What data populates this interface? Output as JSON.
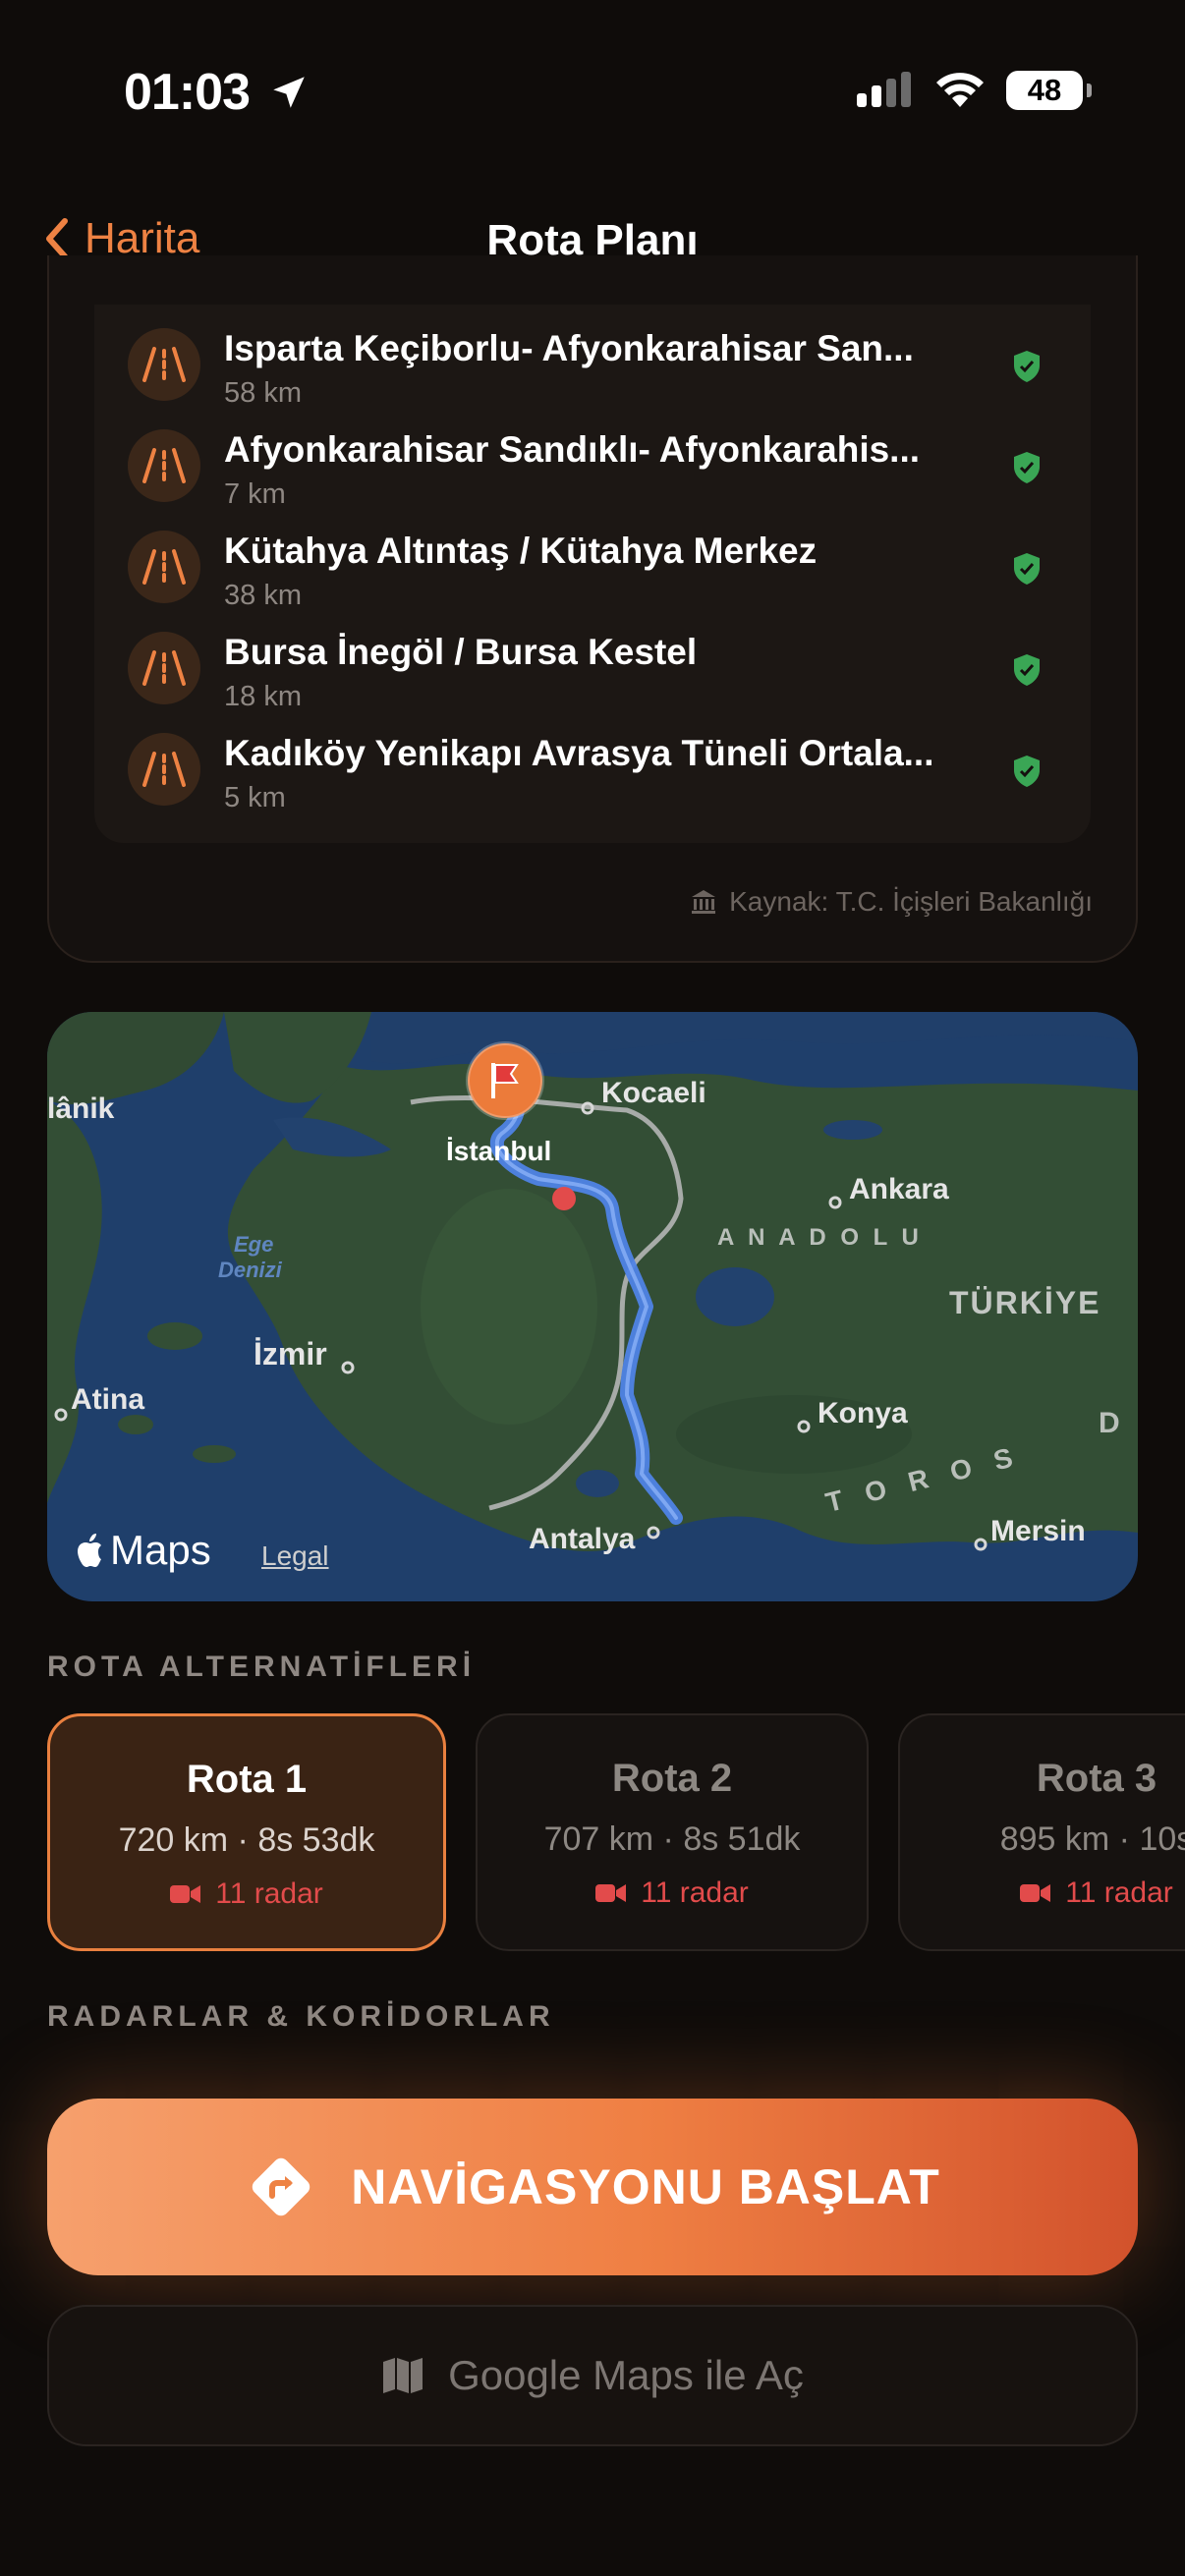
{
  "status": {
    "time": "01:03",
    "battery": "48"
  },
  "nav": {
    "back_label": "Harita",
    "title": "Rota Planı"
  },
  "corridors": [
    {
      "title": "Isparta Keçiborlu- Afyonkarahisar San...",
      "distance": "58 km"
    },
    {
      "title": "Afyonkarahisar Sandıklı- Afyonkarahis...",
      "distance": "7 km"
    },
    {
      "title": "Kütahya Altıntaş / Kütahya Merkez",
      "distance": "38 km"
    },
    {
      "title": "Bursa İnegöl / Bursa Kestel",
      "distance": "18 km"
    },
    {
      "title": "Kadıköy Yenikapı Avrasya Tüneli Ortala...",
      "distance": "5 km"
    }
  ],
  "source": "Kaynak: T.C. İçişleri Bakanlığı",
  "map": {
    "labels": {
      "kocaeli": "Kocaeli",
      "istanbul": "İstanbul",
      "ankara": "Ankara",
      "anadolu": "A N A D O L U",
      "turkiye": "TÜRKİYE",
      "ege1": "Ege",
      "ege2": "Denizi",
      "izmir": "İzmir",
      "atina": "Atina",
      "konya": "Konya",
      "toros": "T O R O S",
      "antalya": "Antalya",
      "mersin": "Mersin",
      "manik": "lânik",
      "d": "D"
    },
    "brand": "Maps",
    "legal": "Legal"
  },
  "alternatives_label": "ROTA ALTERNATİFLERİ",
  "routes": [
    {
      "name": "Rota 1",
      "distance": "720 km",
      "duration": "8s 53dk",
      "radar": "11 radar"
    },
    {
      "name": "Rota 2",
      "distance": "707 km",
      "duration": "8s 51dk",
      "radar": "11 radar"
    },
    {
      "name": "Rota 3",
      "distance": "895 km",
      "duration": "10s",
      "radar": "11 radar"
    }
  ],
  "radars_label": "RADARLAR & KORİDORLAR",
  "start_button": "NAVİGASYONU BAŞLAT",
  "google_button": "Google Maps ile Aç",
  "colors": {
    "accent": "#ee8243",
    "route": "#4f83e6",
    "radar": "#e24b4b",
    "check": "#3aa655"
  }
}
